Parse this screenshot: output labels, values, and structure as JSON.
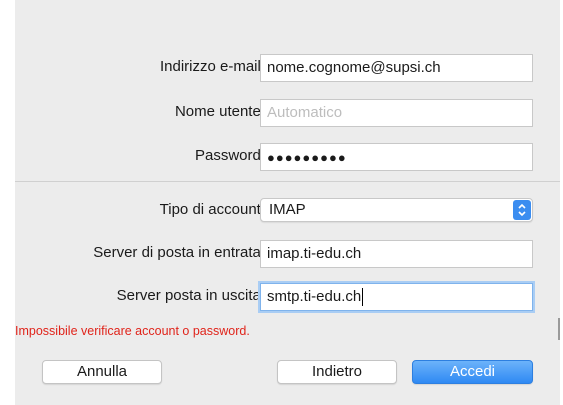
{
  "form": {
    "email": {
      "label": "Indirizzo e-mail:",
      "value": "nome.cognome@supsi.ch"
    },
    "username": {
      "label": "Nome utente:",
      "placeholder": "Automatico"
    },
    "password": {
      "label": "Password:",
      "masked_value": "●●●●●●●●●"
    },
    "account_type": {
      "label": "Tipo di account:",
      "selected": "IMAP"
    },
    "incoming_server": {
      "label": "Server di posta in entrata:",
      "value": "imap.ti-edu.ch"
    },
    "outgoing_server": {
      "label": "Server posta in uscita:",
      "value": "smtp.ti-edu.ch"
    }
  },
  "error_message": "Impossibile verificare account o password.",
  "buttons": {
    "cancel": "Annulla",
    "back": "Indietro",
    "sign_in": "Accedi"
  },
  "colors": {
    "error": "#e0241b",
    "accent": "#2f89f3",
    "focus_ring": "#a9cdf4"
  },
  "icons": {
    "select_arrows": "up-down-chevron-icon"
  }
}
